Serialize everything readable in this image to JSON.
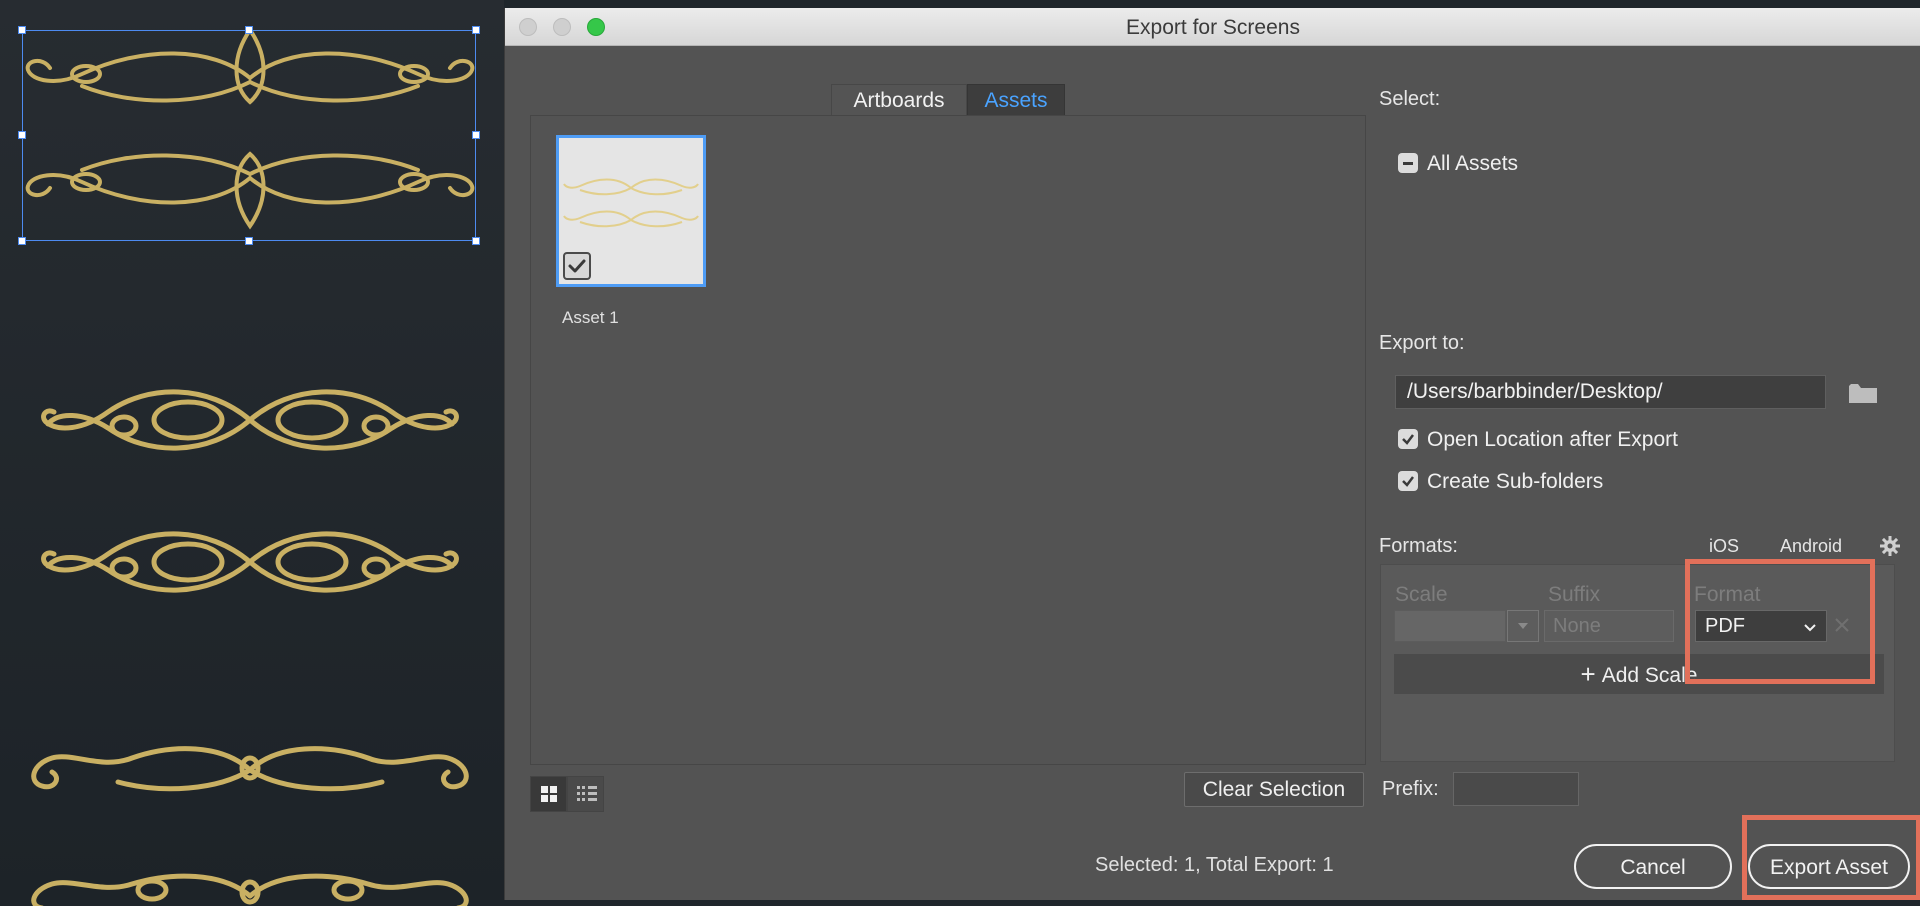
{
  "colors": {
    "accent": "#4e9cf5",
    "tab_active_text": "#4aa3ff",
    "ornament_gold": "#c9b063",
    "highlight": "#e2705a",
    "dialog_bg": "#535353",
    "canvas_bg": "#22282d"
  },
  "dialog": {
    "title": "Export for Screens"
  },
  "tabs": [
    {
      "label": "Artboards",
      "active": false
    },
    {
      "label": "Assets",
      "active": true
    }
  ],
  "assets": {
    "items": [
      {
        "label": "Asset 1",
        "checked": true
      }
    ]
  },
  "view_buttons": {
    "grid_icon": "grid-view-icon",
    "list_icon": "list-view-icon"
  },
  "actions": {
    "clear_selection": "Clear Selection",
    "cancel": "Cancel",
    "export": "Export Asset"
  },
  "status": {
    "text": "Selected: 1, Total Export: 1"
  },
  "select_section": {
    "label": "Select:",
    "all_assets": "All Assets",
    "all_assets_state": "indeterminate"
  },
  "export_to": {
    "label": "Export to:",
    "path": "/Users/barbbinder/Desktop/",
    "folder_icon": "folder-icon",
    "open_location_label": "Open Location after Export",
    "open_location_checked": true,
    "sub_folders_label": "Create Sub-folders",
    "sub_folders_checked": true
  },
  "formats": {
    "label": "Formats:",
    "ios": "iOS",
    "android": "Android",
    "settings_icon": "gear-icon",
    "columns": {
      "scale": "Scale",
      "suffix": "Suffix",
      "format": "Format"
    },
    "row": {
      "scale": "",
      "suffix_placeholder": "None",
      "format": "PDF"
    },
    "add_scale": "Add Scale"
  },
  "prefix": {
    "label": "Prefix:",
    "value": ""
  }
}
